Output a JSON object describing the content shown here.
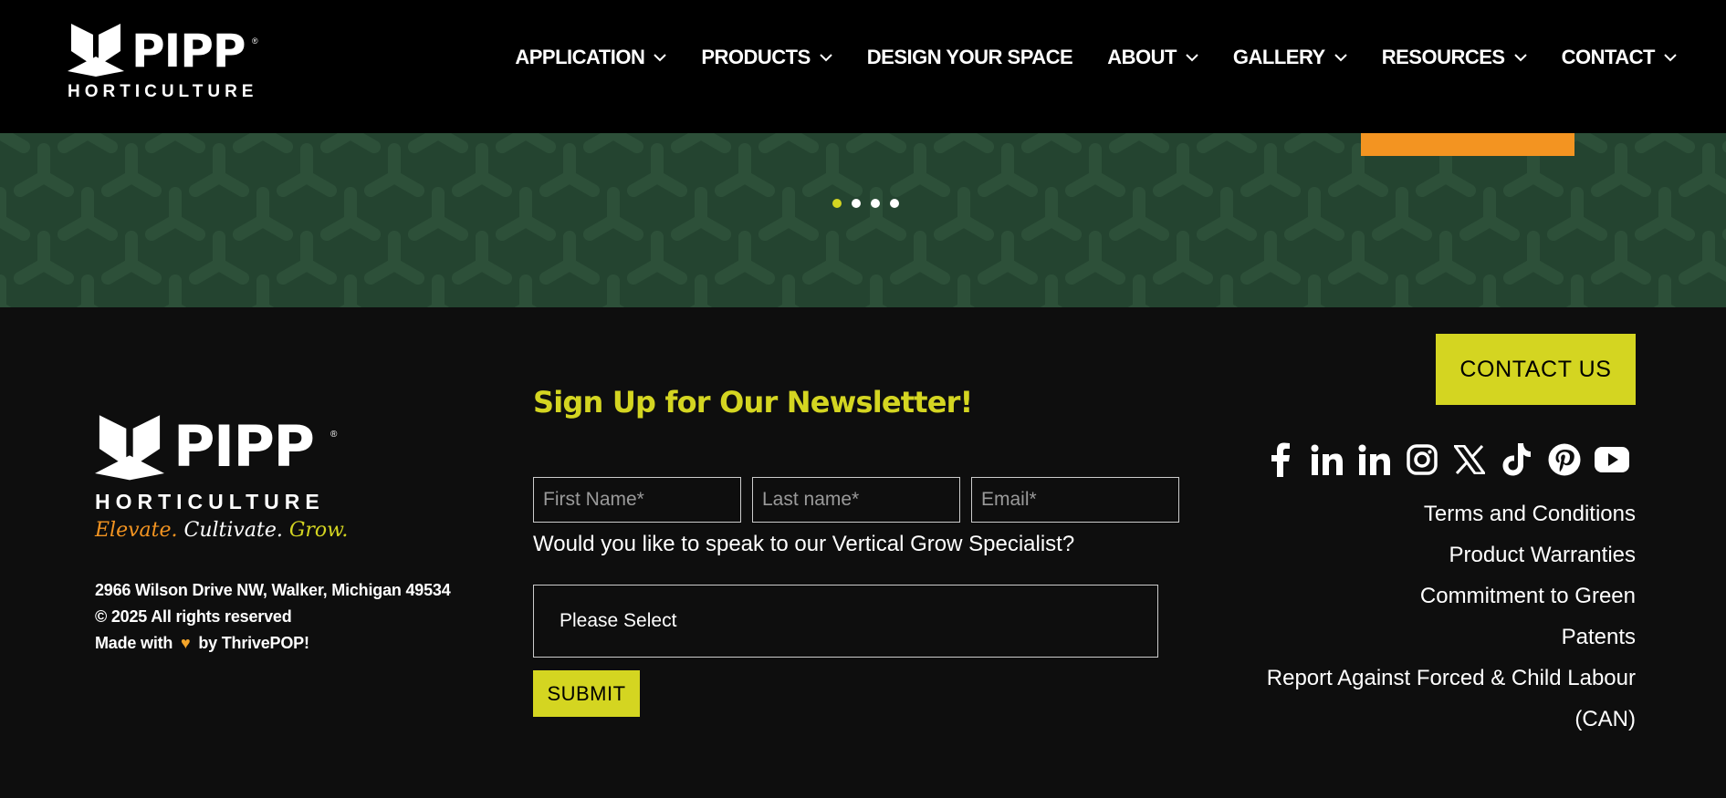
{
  "header": {
    "logo_word": "PIPP",
    "logo_sub": "HORTICULTURE",
    "reg_mark": "®",
    "nav": [
      {
        "label": "APPLICATION",
        "has_dropdown": true
      },
      {
        "label": "PRODUCTS",
        "has_dropdown": true
      },
      {
        "label": "DESIGN YOUR SPACE",
        "has_dropdown": false
      },
      {
        "label": "ABOUT",
        "has_dropdown": true
      },
      {
        "label": "GALLERY",
        "has_dropdown": true
      },
      {
        "label": "RESOURCES",
        "has_dropdown": true
      },
      {
        "label": "CONTACT",
        "has_dropdown": true
      }
    ]
  },
  "hero": {
    "carousel": {
      "slides": 4,
      "active_index": 0
    },
    "colors": {
      "background": "#244430",
      "cta": "#f39421",
      "active_dot": "#d4d521"
    }
  },
  "footer": {
    "logo_word": "PIPP",
    "logo_sub": "HORTICULTURE",
    "reg_mark": "®",
    "tagline": {
      "part1": "Elevate.",
      "part2": "Cultivate.",
      "part3": "Grow."
    },
    "address": "2966 Wilson Drive NW, Walker, Michigan 49534",
    "copyright": "© 2025 All rights reserved",
    "made_with_prefix": "Made with",
    "made_with_suffix": "by ThrivePOP!",
    "heart_icon": "heart-icon",
    "newsletter": {
      "title": "Sign Up for Our Newsletter!",
      "first_name_placeholder": "First Name*",
      "last_name_placeholder": "Last name*",
      "email_placeholder": "Email*",
      "question": "Would you like to speak to our Vertical Grow Specialist?",
      "select_value": "Please Select",
      "submit_label": "SUBMIT"
    },
    "contact_button": "CONTACT US",
    "social_icons": [
      "facebook-icon",
      "linkedin-icon",
      "linkedin-icon",
      "instagram-icon",
      "x-icon",
      "tiktok-icon",
      "pinterest-icon",
      "youtube-icon"
    ],
    "links": [
      "Terms and Conditions",
      "Product Warranties",
      "Commitment to Green",
      "Patents",
      "Report Against Forced & Child Labour",
      "(CAN)"
    ],
    "accent_color": "#d4d521"
  }
}
